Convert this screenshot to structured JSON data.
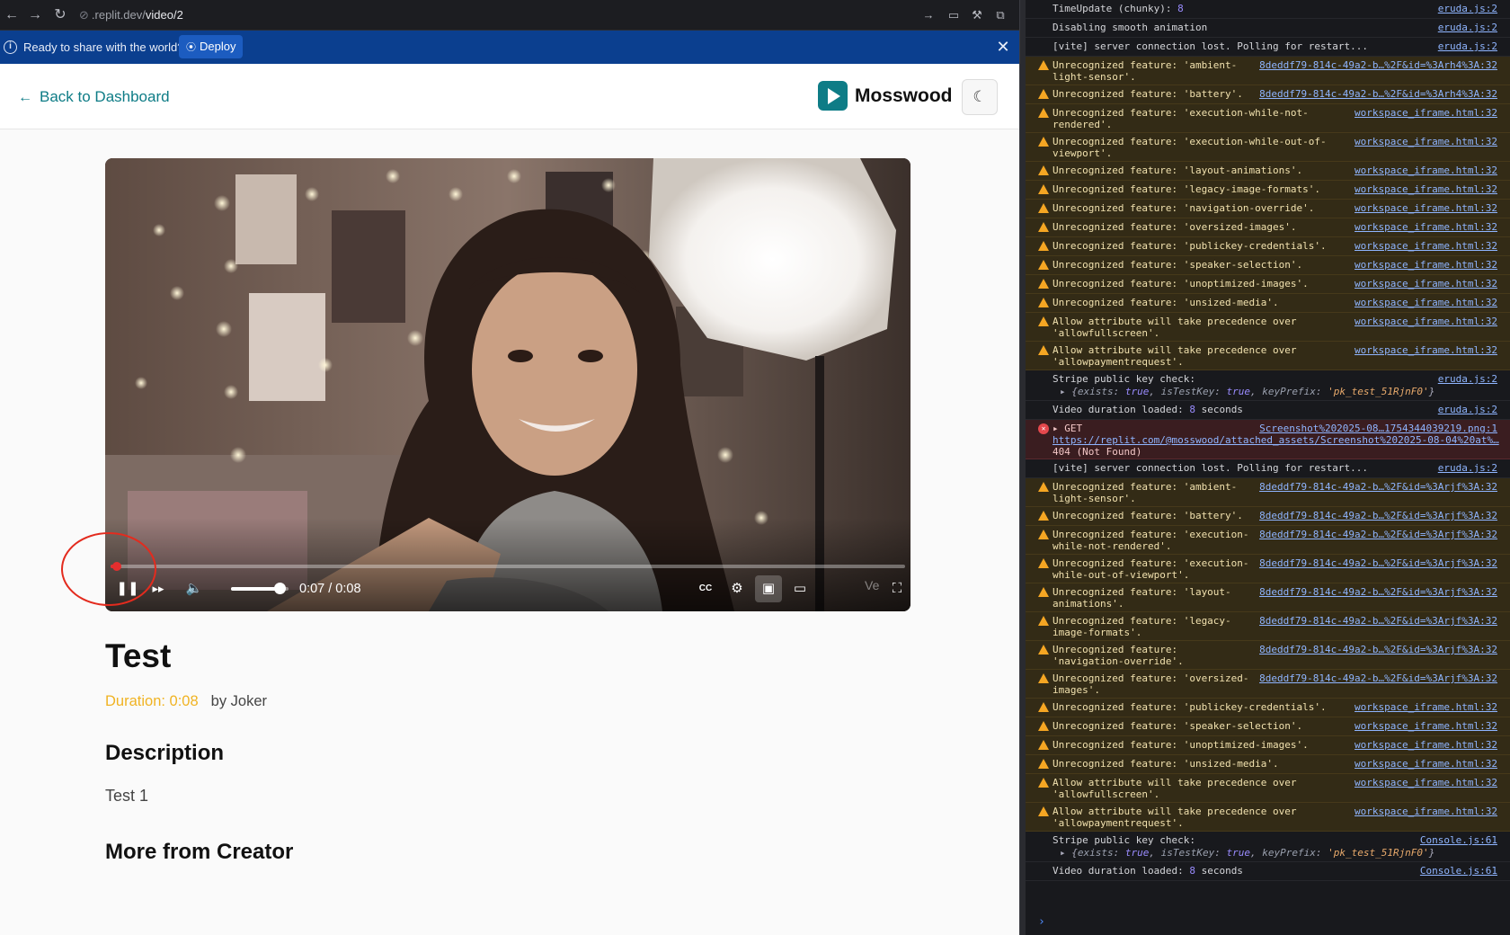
{
  "browser": {
    "url_host": ".replit.dev/",
    "url_path": "video/2"
  },
  "deploy_banner": {
    "message": "Ready to share with the world?",
    "deploy_label": "Deploy"
  },
  "header": {
    "back_label": "Back to Dashboard",
    "brand_name": "Mosswood"
  },
  "player": {
    "current_time": "0:07",
    "duration": "0:08",
    "timecode": "0:07 / 0:08",
    "progress_fraction": 0.008,
    "volume_fraction": 0.85,
    "watermark": "Ve",
    "accent_color": "#e52e2e"
  },
  "video": {
    "title": "Test",
    "duration_label": "Duration: 0:08",
    "creator": "by Joker",
    "description_heading": "Description",
    "description": "Test 1",
    "more_heading": "More from Creator"
  },
  "console": {
    "rows": [
      {
        "type": "log",
        "msg": "TimeUpdate (chunky): ",
        "num": "8",
        "src": "eruda.js:2"
      },
      {
        "type": "log",
        "msg": "Disabling smooth animation",
        "src": "eruda.js:2"
      },
      {
        "type": "log",
        "msg": "[vite] server connection lost. Polling for restart...",
        "src": "eruda.js:2"
      },
      {
        "type": "warn",
        "msg": "Unrecognized feature: 'ambient-\nlight-sensor'.",
        "src": "8deddf79-814c-49a2-b…%2F&id=%3Arh4%3A:32"
      },
      {
        "type": "warn",
        "msg": "Unrecognized feature: 'battery'.",
        "src": "8deddf79-814c-49a2-b…%2F&id=%3Arh4%3A:32"
      },
      {
        "type": "warn",
        "msg": "Unrecognized feature: 'execution-while-not-\nrendered'.",
        "src": "workspace_iframe.html:32"
      },
      {
        "type": "warn",
        "msg": "Unrecognized feature: 'execution-while-out-of-\nviewport'.",
        "src": "workspace_iframe.html:32"
      },
      {
        "type": "warn",
        "msg": "Unrecognized feature: 'layout-animations'.",
        "src": "workspace_iframe.html:32"
      },
      {
        "type": "warn",
        "msg": "Unrecognized feature: 'legacy-image-formats'.",
        "src": "workspace_iframe.html:32"
      },
      {
        "type": "warn",
        "msg": "Unrecognized feature: 'navigation-override'.",
        "src": "workspace_iframe.html:32"
      },
      {
        "type": "warn",
        "msg": "Unrecognized feature: 'oversized-images'.",
        "src": "workspace_iframe.html:32"
      },
      {
        "type": "warn",
        "msg": "Unrecognized feature: 'publickey-credentials'.",
        "src": "workspace_iframe.html:32"
      },
      {
        "type": "warn",
        "msg": "Unrecognized feature: 'speaker-selection'.",
        "src": "workspace_iframe.html:32"
      },
      {
        "type": "warn",
        "msg": "Unrecognized feature: 'unoptimized-images'.",
        "src": "workspace_iframe.html:32"
      },
      {
        "type": "warn",
        "msg": "Unrecognized feature: 'unsized-media'.",
        "src": "workspace_iframe.html:32"
      },
      {
        "type": "warn",
        "msg": "Allow attribute will take precedence over\n'allowfullscreen'.",
        "src": "workspace_iframe.html:32"
      },
      {
        "type": "warn",
        "msg": "Allow attribute will take precedence over\n'allowpaymentrequest'.",
        "src": "workspace_iframe.html:32"
      },
      {
        "type": "obj",
        "msg": "Stripe public key check:",
        "src": "eruda.js:2",
        "exists": "true",
        "isTestKey": "true",
        "keyPrefix": "'pk_test_51RjnF0'"
      },
      {
        "type": "log",
        "msg": "Video duration loaded: ",
        "num": "8",
        "tail": " seconds",
        "src": "eruda.js:2"
      },
      {
        "type": "err",
        "msg": "▸ GET",
        "src": "Screenshot%202025-08…1754344039219.png:1",
        "url": "https://replit.com/@mosswood/attached_assets/Screenshot%202025-08-04%20at%…",
        "status": "404 (Not Found)"
      },
      {
        "type": "log",
        "msg": "[vite] server connection lost. Polling for restart...",
        "src": "eruda.js:2"
      },
      {
        "type": "warn",
        "msg": "Unrecognized feature: 'ambient-\nlight-sensor'.",
        "src": "8deddf79-814c-49a2-b…%2F&id=%3Arjf%3A:32"
      },
      {
        "type": "warn",
        "msg": "Unrecognized feature: 'battery'.",
        "src": "8deddf79-814c-49a2-b…%2F&id=%3Arjf%3A:32"
      },
      {
        "type": "warn",
        "msg": "Unrecognized feature: 'execution-\nwhile-not-rendered'.",
        "src": "8deddf79-814c-49a2-b…%2F&id=%3Arjf%3A:32"
      },
      {
        "type": "warn",
        "msg": "Unrecognized feature: 'execution-\nwhile-out-of-viewport'.",
        "src": "8deddf79-814c-49a2-b…%2F&id=%3Arjf%3A:32"
      },
      {
        "type": "warn",
        "msg": "Unrecognized feature: 'layout-\nanimations'.",
        "src": "8deddf79-814c-49a2-b…%2F&id=%3Arjf%3A:32"
      },
      {
        "type": "warn",
        "msg": "Unrecognized feature: 'legacy-\nimage-formats'.",
        "src": "8deddf79-814c-49a2-b…%2F&id=%3Arjf%3A:32"
      },
      {
        "type": "warn",
        "msg": "Unrecognized feature:\n'navigation-override'.",
        "src": "8deddf79-814c-49a2-b…%2F&id=%3Arjf%3A:32"
      },
      {
        "type": "warn",
        "msg": "Unrecognized feature: 'oversized-\nimages'.",
        "src": "8deddf79-814c-49a2-b…%2F&id=%3Arjf%3A:32"
      },
      {
        "type": "warn",
        "msg": "Unrecognized feature: 'publickey-credentials'.",
        "src": "workspace_iframe.html:32"
      },
      {
        "type": "warn",
        "msg": "Unrecognized feature: 'speaker-selection'.",
        "src": "workspace_iframe.html:32"
      },
      {
        "type": "warn",
        "msg": "Unrecognized feature: 'unoptimized-images'.",
        "src": "workspace_iframe.html:32"
      },
      {
        "type": "warn",
        "msg": "Unrecognized feature: 'unsized-media'.",
        "src": "workspace_iframe.html:32"
      },
      {
        "type": "warn",
        "msg": "Allow attribute will take precedence over\n'allowfullscreen'.",
        "src": "workspace_iframe.html:32"
      },
      {
        "type": "warn",
        "msg": "Allow attribute will take precedence over\n'allowpaymentrequest'.",
        "src": "workspace_iframe.html:32"
      },
      {
        "type": "obj",
        "msg": "Stripe public key check:",
        "src": "Console.js:61",
        "exists": "true",
        "isTestKey": "true",
        "keyPrefix": "'pk_test_51RjnF0'"
      },
      {
        "type": "log",
        "msg": "Video duration loaded: ",
        "num": "8",
        "tail": " seconds",
        "src": "Console.js:61"
      }
    ]
  }
}
